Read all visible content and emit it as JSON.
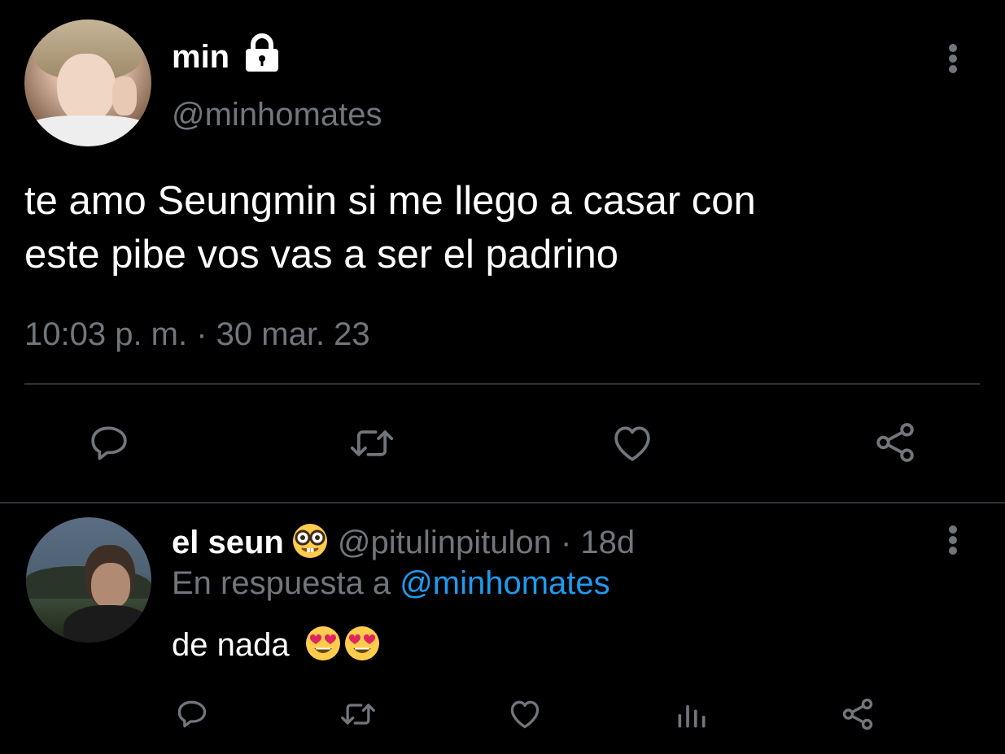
{
  "main_tweet": {
    "display_name": "min",
    "handle": "@minhomates",
    "text": "te amo Seungmin si me llego a casar con\neste pibe vos vas a ser el padrino",
    "timestamp": "10:03 p. m. · 30 mar. 23",
    "icons": [
      "lock-icon",
      "more-icon",
      "reply-icon",
      "retweet-icon",
      "like-icon",
      "share-icon"
    ]
  },
  "reply_tweet": {
    "display_name": "el seun",
    "handle": "@pitulinpitulon",
    "separator": "·",
    "age": "18d",
    "reply_prefix": "En respuesta a",
    "reply_mention": "@minhomates",
    "text": "de nada",
    "icons": [
      "nerd-face-emoji",
      "heart-eyes-emoji",
      "reply-icon",
      "retweet-icon",
      "like-icon",
      "views-icon",
      "share-icon"
    ]
  },
  "colors": {
    "background": "#000000",
    "primary_text": "#ffffff",
    "secondary_text": "#71767b",
    "divider": "#2f3336",
    "link": "#1d9bf0"
  }
}
